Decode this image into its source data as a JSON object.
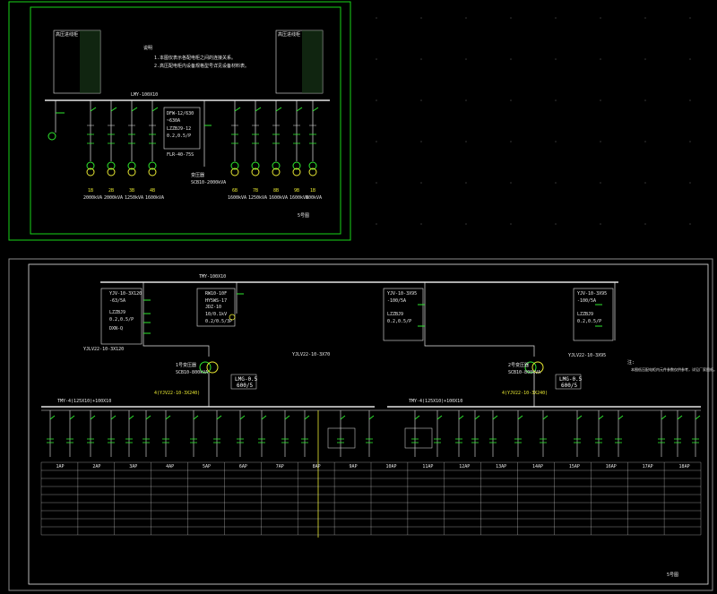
{
  "colors": {
    "background": "#000000",
    "frame_green": "#19d419",
    "frame_gray": "#8a8a8a",
    "line_white": "#e6e6e6",
    "yellow": "#e8e832",
    "switch_green": "#2ee82e",
    "grid_dot": "#3a3a3a"
  },
  "top_drawing": {
    "notes_title": "说明",
    "note_1": "1.本图仅表示各配电柜之间的连接关系。",
    "note_2": "2.高压配电柜内设备规格型号详见设备材料表。",
    "left_panel_title": "高压进线柜",
    "right_panel_title": "高压进线柜",
    "busbar_label": "LMY-100X10",
    "center_box": [
      "DFW-12/630",
      "~630A",
      "LZZBJ9-12",
      "0.2,0.5/P",
      "FLR-40-75S"
    ],
    "transformer_text": [
      "变压器",
      "SCB10-2000kVA"
    ],
    "feeders": [
      {
        "id": "1B",
        "kva": "2000kVA"
      },
      {
        "id": "2B",
        "kva": "2000kVA"
      },
      {
        "id": "3B",
        "kva": "1250kVA"
      },
      {
        "id": "4B",
        "kva": "1600kVA"
      },
      {
        "id": "6B",
        "kva": "1600kVA"
      },
      {
        "id": "7B",
        "kva": "1250kVA"
      },
      {
        "id": "8B",
        "kva": "1600kVA"
      },
      {
        "id": "9B",
        "kva": "1600kVA"
      },
      {
        "id": "1B",
        "kva": "800kVA"
      }
    ],
    "sheet_label": "5号图"
  },
  "bottom_drawing": {
    "top_bus": "TMY-100X10",
    "cable_center": "YJLV22-10-3X70",
    "cable_left": "YJLV22-10-3X120",
    "cable_right": "YJLV22-10-3X95",
    "hv_left_box": [
      "YJV-10-3X120",
      "-63/5A",
      "LZZBJ9",
      "0.2,0.5/P",
      "DXN-Q"
    ],
    "hv_mid_box": [
      "RW10-10F",
      "HY5WS-17",
      "JDZ-10",
      "10/0.1kV",
      "0.2/0.5/3P"
    ],
    "hv_right_box1": [
      "YJV-10-3X95",
      "-100/5A",
      "LZZBJ9",
      "0.2,0.5/P"
    ],
    "hv_right_box2": [
      "YJV-10-3X95",
      "-100/5A",
      "LZZBJ9",
      "0.2,0.5/P"
    ],
    "transformer_left": [
      "1号变压器",
      "SCB10-800kVA"
    ],
    "transformer_right": [
      "2号变压器",
      "SCB10-800kVA"
    ],
    "meter_left": [
      "LMG-0.5",
      "600/5"
    ],
    "meter_right": [
      "LMG-0.5",
      "600/5"
    ],
    "bus_cable_left": "4(YJV22-10-3X240)",
    "bus_cable_right": "4(YJV22-10-3X240)",
    "lv_bus_left": "TMY-4(125X10)+100X10",
    "lv_bus_right": "TMY-4(125X10)+100X10",
    "note": "注:",
    "note_text": "本图低压配电柜内元件参数仅供参考，详见厂家图纸。",
    "panels": [
      "1AP",
      "2AP",
      "3AP",
      "4AP",
      "5AP",
      "6AP",
      "7AP",
      "8AP",
      "9AP",
      "10AP",
      "11AP",
      "12AP",
      "13AP",
      "14AP",
      "15AP",
      "16AP",
      "17AP",
      "18AP"
    ],
    "row_labels": [
      "柜号",
      "柜型",
      "用途",
      "断路器",
      "互感器",
      "电流表",
      "电缆",
      "容量",
      "备注"
    ],
    "sheet_label": "5号图"
  }
}
